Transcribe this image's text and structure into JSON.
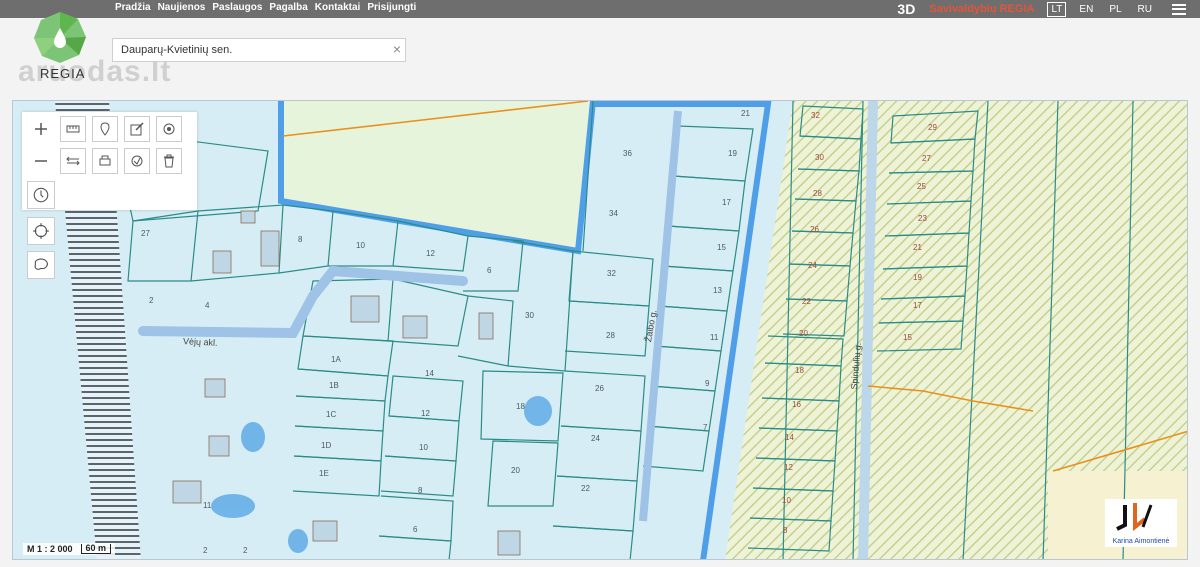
{
  "nav": {
    "items": [
      "Pradžia",
      "Naujienos",
      "Paslaugos",
      "Pagalba",
      "Kontaktai",
      "Prisijungti"
    ],
    "view_3d": "3D",
    "brand": "Savivaldybių REGIA",
    "languages": [
      "LT",
      "EN",
      "PL",
      "RU"
    ],
    "active_language": "LT"
  },
  "logo": {
    "text": "REGIA",
    "watermark": "aruodas.lt"
  },
  "search": {
    "value": "Dauparų-Kvietinių sen.",
    "clear": "×"
  },
  "map": {
    "scale_text": "M 1 : 2 000",
    "scale_bar_label": "60 m",
    "street_labels": [
      "Vėjų akl.",
      "Žaibo g.",
      "Spindulių g."
    ],
    "parcel_labels": [
      "21",
      "32",
      "29",
      "36",
      "19",
      "30",
      "27",
      "28",
      "25",
      "34",
      "17",
      "23",
      "26",
      "21",
      "15",
      "24",
      "19",
      "32",
      "13",
      "22",
      "17",
      "28",
      "11",
      "20",
      "15",
      "30",
      "27",
      "8",
      "10",
      "12",
      "6",
      "2",
      "4",
      "1A",
      "14",
      "1B",
      "1C",
      "12",
      "1D",
      "10",
      "1E",
      "8",
      "6",
      "18",
      "26",
      "24",
      "22",
      "20",
      "9",
      "7",
      "18",
      "16",
      "14",
      "12",
      "10",
      "8",
      "11",
      "2",
      "2"
    ],
    "agent_name": "Karina Aimontienė",
    "colors": {
      "map_fill": "#d7edf5",
      "parcel_line": "#2a8c86",
      "boundary": "#4f9fe8",
      "green_zone": "#e7f4dc",
      "hatch": "#cfd89a",
      "road_line": "#e8901a"
    }
  },
  "toolbar": {
    "icons": [
      "zoom-in-icon",
      "measure-ruler-icon",
      "marker-icon",
      "edit-icon",
      "target-icon",
      "zoom-out-icon",
      "measure-distance-icon",
      "print-icon",
      "layers-icon",
      "trash-icon"
    ],
    "side_icons": [
      "history-icon",
      "locate-icon",
      "area-select-icon"
    ]
  }
}
